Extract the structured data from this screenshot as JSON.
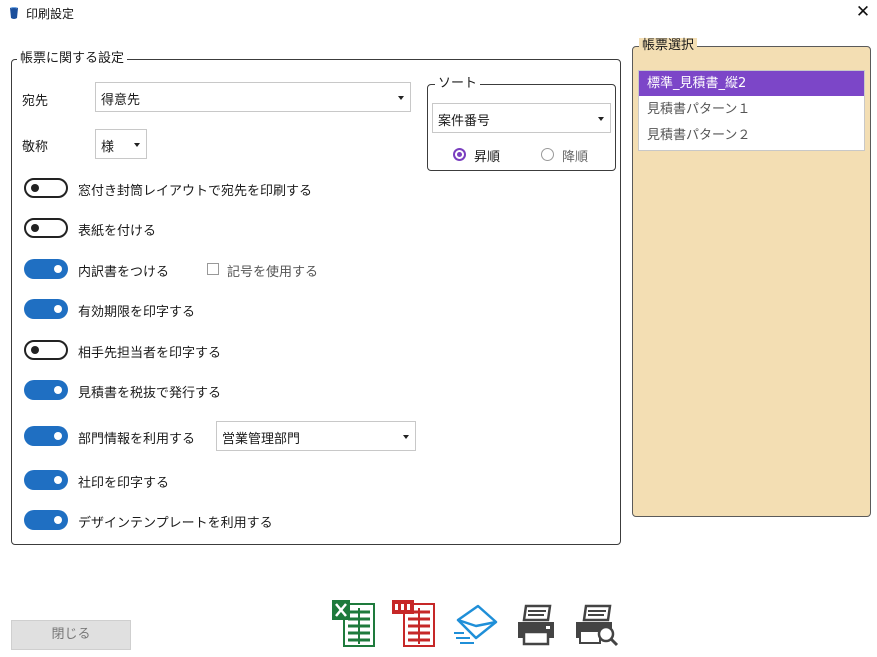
{
  "window": {
    "title": "印刷設定",
    "close_glyph": "✕"
  },
  "main_group": {
    "legend": "帳票に関する設定",
    "recipient": {
      "label": "宛先",
      "value": "得意先"
    },
    "honorific": {
      "label": "敬称",
      "value": "様"
    },
    "sort": {
      "legend": "ソート",
      "value": "案件番号",
      "ascending_label": "昇順",
      "descending_label": "降順",
      "selected": "ascending"
    },
    "toggles": [
      {
        "label": "窓付き封筒レイアウトで宛先を印刷する",
        "on": false
      },
      {
        "label": "表紙を付ける",
        "on": false
      },
      {
        "label": "内訳書をつける",
        "on": true
      },
      {
        "label": "有効期限を印字する",
        "on": true
      },
      {
        "label": "相手先担当者を印字する",
        "on": false
      },
      {
        "label": "見積書を税抜で発行する",
        "on": true
      },
      {
        "label": "部門情報を利用する",
        "on": true
      },
      {
        "label": "社印を印字する",
        "on": true
      },
      {
        "label": "デザインテンプレートを利用する",
        "on": true
      }
    ],
    "symbol_checkbox": {
      "label": "記号を使用する",
      "checked": false
    },
    "department": {
      "value": "営業管理部門"
    }
  },
  "form_select": {
    "legend": "帳票選択",
    "items": [
      "標準_見積書_縦2",
      "見積書パターン１",
      "見積書パターン２"
    ],
    "selected_index": 0
  },
  "footer": {
    "close_label": "閉じる",
    "icons": [
      "excel-export-icon",
      "pdf-export-icon",
      "email-send-icon",
      "print-icon",
      "print-preview-icon"
    ]
  },
  "colors": {
    "toggle_on": "#1f6fc2",
    "selection": "#7c46c8",
    "form_panel": "#f3deb3",
    "radio": "#7a3fbf"
  }
}
